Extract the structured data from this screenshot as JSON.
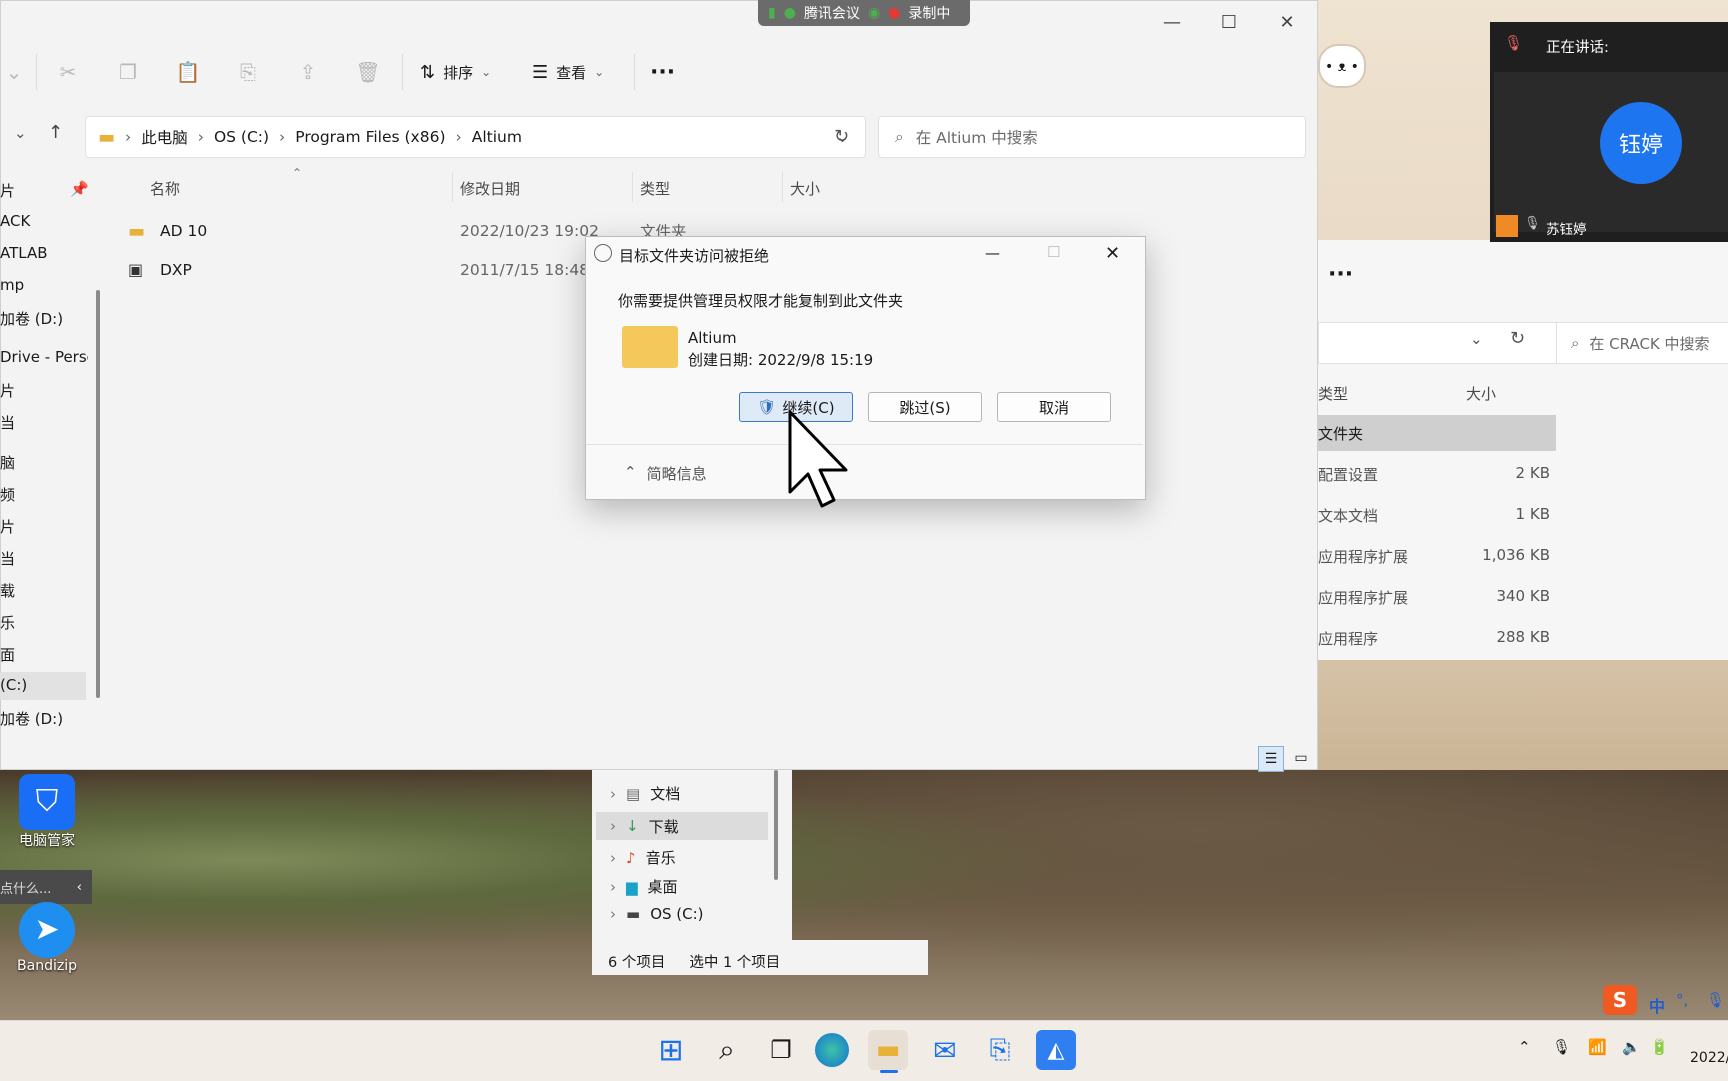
{
  "meeting_bar": {
    "app": "腾讯会议",
    "recording": "录制中"
  },
  "explorer": {
    "toolbar": {
      "sort": "排序",
      "view": "查看",
      "more": "···"
    },
    "address": {
      "root": "此电脑",
      "drive": "OS (C:)",
      "folder1": "Program Files (x86)",
      "folder2": "Altium"
    },
    "search_placeholder": "在 Altium 中搜索",
    "nav": [
      "片",
      "ACK",
      "ATLAB",
      "mp",
      "加卷 (D:)",
      "Drive - Perso",
      "片",
      "当",
      "脑",
      "频",
      "片",
      "当",
      "载",
      "乐",
      "面",
      "(C:)",
      "加卷 (D:)"
    ],
    "columns": {
      "name": "名称",
      "date": "修改日期",
      "type": "类型",
      "size": "大小"
    },
    "rows": [
      {
        "name": "AD 10",
        "date": "2022/10/23 19:02",
        "type": "文件夹"
      },
      {
        "name": "DXP",
        "date": "2011/7/15 18:48",
        "type": ""
      }
    ]
  },
  "explorer2": {
    "search_placeholder": "在 CRACK 中搜索",
    "columns": {
      "type": "类型",
      "size": "大小"
    },
    "rows": [
      {
        "type": "文件夹",
        "size": ""
      },
      {
        "type": "配置设置",
        "size": "2 KB"
      },
      {
        "type": "文本文档",
        "size": "1 KB"
      },
      {
        "type": "应用程序扩展",
        "size": "1,036 KB"
      },
      {
        "type": "应用程序扩展",
        "size": "340 KB"
      },
      {
        "type": "应用程序",
        "size": "288 KB"
      }
    ],
    "tree": [
      "文档",
      "下载",
      "音乐",
      "桌面",
      "OS (C:)"
    ],
    "status": {
      "count": "6 个项目",
      "selected": "选中 1 个项目"
    },
    "more": "···"
  },
  "dialog": {
    "title": "目标文件夹访问被拒绝",
    "message": "你需要提供管理员权限才能复制到此文件夹",
    "folder_name": "Altium",
    "created": "创建日期: 2022/9/8 15:19",
    "continue": "继续(C)",
    "skip": "跳过(S)",
    "cancel": "取消",
    "details": "简略信息"
  },
  "desktop": {
    "icon1": "电脑管家",
    "icon2": "Bandizip",
    "tooltip": "点什么..."
  },
  "meeting": {
    "speaking": "正在讲话:",
    "avatar_text": "钰婷",
    "participant": "苏钰婷"
  },
  "taskbar": {
    "ime": "中",
    "date": "2022/"
  }
}
